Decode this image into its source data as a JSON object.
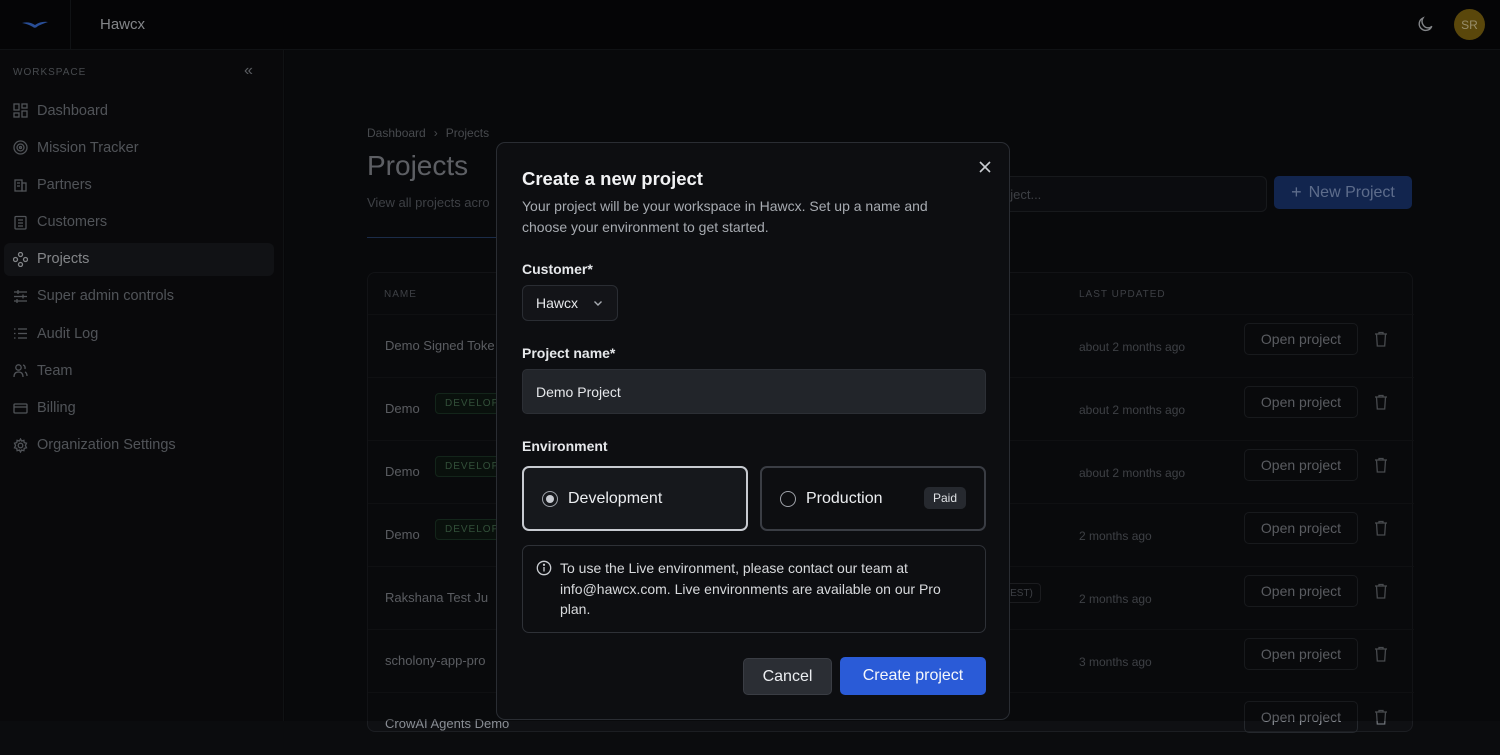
{
  "app": {
    "name": "Hawcx",
    "avatar_initials": "SR"
  },
  "sidebar": {
    "section_label": "WORKSPACE",
    "items": [
      {
        "label": "Dashboard",
        "icon": "dashboard-icon"
      },
      {
        "label": "Mission Tracker",
        "icon": "target-icon"
      },
      {
        "label": "Partners",
        "icon": "building-icon"
      },
      {
        "label": "Customers",
        "icon": "clipboard-icon"
      },
      {
        "label": "Projects",
        "icon": "projects-icon",
        "active": true
      },
      {
        "label": "Super admin controls",
        "icon": "sliders-icon"
      },
      {
        "label": "Audit Log",
        "icon": "list-icon"
      },
      {
        "label": "Team",
        "icon": "users-icon"
      },
      {
        "label": "Billing",
        "icon": "card-icon"
      },
      {
        "label": "Organization Settings",
        "icon": "gear-icon"
      }
    ]
  },
  "main": {
    "breadcrumb": [
      "Dashboard",
      "Projects"
    ],
    "title": "Projects",
    "subtitle": "View all projects acro",
    "search_placeholder": "oject...",
    "new_project_label": "New Project",
    "table": {
      "headers": {
        "name": "NAME",
        "last_updated": "LAST UPDATED"
      },
      "open_label": "Open project",
      "rows": [
        {
          "name": "Demo Signed Toke",
          "tag": "",
          "test": "",
          "updated": "about 2 months ago"
        },
        {
          "name": "Demo",
          "tag": "DEVELOP",
          "test": "",
          "updated": "about 2 months ago"
        },
        {
          "name": "Demo",
          "tag": "DEVELOP",
          "test": "",
          "updated": "about 2 months ago"
        },
        {
          "name": "Demo",
          "tag": "DEVELOP",
          "test": "",
          "updated": "2 months ago"
        },
        {
          "name": "Rakshana Test Ju",
          "tag": "",
          "test": "TEST)",
          "updated": "2 months ago"
        },
        {
          "name": "scholony-app-pro",
          "tag": "",
          "test": "",
          "updated": "3 months ago"
        },
        {
          "name": "CrowAI Agents Demo",
          "tag": "",
          "test": "",
          "updated": ""
        }
      ]
    }
  },
  "modal": {
    "title": "Create a new project",
    "description": "Your project will be your workspace in Hawcx. Set up a name and choose your environment to get started.",
    "customer_label": "Customer*",
    "customer_value": "Hawcx",
    "project_name_label": "Project name*",
    "project_name_value": "Demo Project",
    "environment_label": "Environment",
    "env_options": {
      "development": "Development",
      "production": "Production",
      "paid_badge": "Paid",
      "selected": "Development"
    },
    "info_text": "To use the Live environment, please contact our team at info@hawcx.com. Live environments are available on our Pro plan.",
    "cancel_label": "Cancel",
    "create_label": "Create project"
  },
  "colors": {
    "accent": "#2a5bd7",
    "background": "#0b0c0e",
    "avatar": "#8a6d12"
  }
}
